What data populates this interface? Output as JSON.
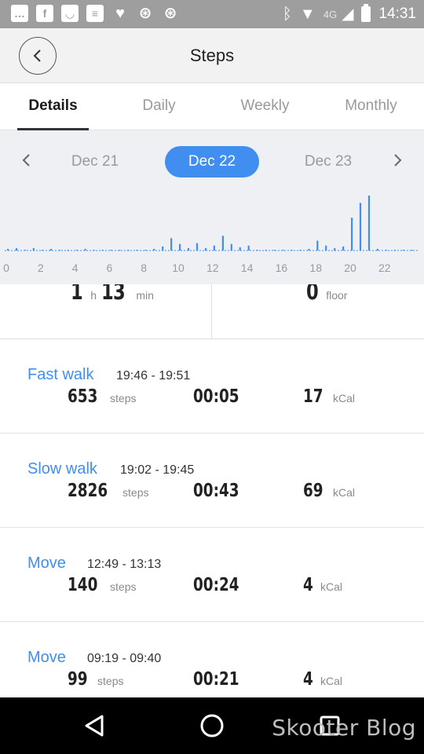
{
  "status_bar": {
    "network": "4G",
    "time": "14:31",
    "icons": [
      "message-icon",
      "facebook-icon",
      "smile-icon",
      "news-icon",
      "heart-icon",
      "globe-icon",
      "globe-icon",
      "bluetooth-icon",
      "wifi-icon",
      "signal-icon",
      "battery-icon"
    ]
  },
  "header": {
    "title": "Steps"
  },
  "tabs": [
    {
      "label": "Details",
      "active": true
    },
    {
      "label": "Daily",
      "active": false
    },
    {
      "label": "Weekly",
      "active": false
    },
    {
      "label": "Monthly",
      "active": false
    }
  ],
  "date_nav": {
    "prev": "Dec 21",
    "current": "Dec 22",
    "next": "Dec 23"
  },
  "chart_data": {
    "type": "bar",
    "x": [
      0,
      0.5,
      1,
      1.5,
      2,
      2.5,
      3,
      3.5,
      4,
      4.5,
      5,
      5.5,
      6,
      6.5,
      7,
      7.5,
      8,
      8.5,
      9,
      9.5,
      10,
      10.5,
      11,
      11.5,
      12,
      12.5,
      13,
      13.5,
      14,
      14.5,
      15,
      15.5,
      16,
      16.5,
      17,
      17.5,
      18,
      18.5,
      19,
      19.5,
      20,
      20.5,
      21,
      21.5,
      22,
      22.5,
      23,
      23.5
    ],
    "x_ticks": [
      "0",
      "2",
      "4",
      "6",
      "8",
      "10",
      "12",
      "14",
      "16",
      "18",
      "20",
      "22"
    ],
    "values": [
      2,
      3,
      1,
      3,
      1,
      2,
      1,
      1,
      1,
      2,
      1,
      1,
      1,
      1,
      1,
      1,
      1,
      2,
      5,
      15,
      8,
      3,
      9,
      3,
      6,
      18,
      8,
      4,
      6,
      1,
      1,
      1,
      1,
      1,
      1,
      2,
      12,
      6,
      3,
      5,
      40,
      58,
      67,
      2,
      1,
      1,
      1,
      1
    ],
    "color": "#3f8ef0",
    "xlim": [
      0,
      24
    ]
  },
  "summary": {
    "hours": "1",
    "hours_unit": "h",
    "minutes": "13",
    "minutes_unit": "min",
    "floors": "0",
    "floors_unit": "floor"
  },
  "activities": [
    {
      "type": "Fast walk",
      "time": "19:46 - 19:51",
      "steps": "653",
      "steps_unit": "steps",
      "duration": "00:05",
      "kcal": "17",
      "kcal_unit": "kCal"
    },
    {
      "type": "Slow walk",
      "time": "19:02 - 19:45",
      "steps": "2826",
      "steps_unit": "steps",
      "duration": "00:43",
      "kcal": "69",
      "kcal_unit": "kCal"
    },
    {
      "type": "Move",
      "time": "12:49 - 13:13",
      "steps": "140",
      "steps_unit": "steps",
      "duration": "00:24",
      "kcal": "4",
      "kcal_unit": "kCal"
    },
    {
      "type": "Move",
      "time": "09:19 - 09:40",
      "steps": "99",
      "steps_unit": "steps",
      "duration": "00:21",
      "kcal": "4",
      "kcal_unit": "kCal"
    }
  ],
  "watermark": "Skooter Blog",
  "colors": {
    "accent": "#3f8ef0",
    "status_bar": "#9e9e9e",
    "chart_bg": "#eef0f3"
  }
}
